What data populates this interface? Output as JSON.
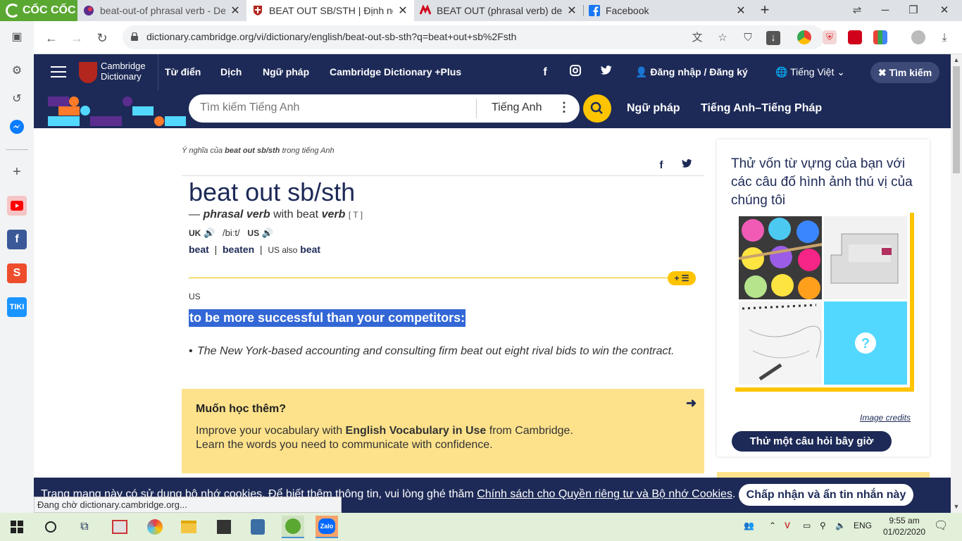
{
  "browser": {
    "brand": "CỐC CỐC",
    "tabs": [
      {
        "title": "beat-out-of phrasal verb - De",
        "active": false
      },
      {
        "title": "BEAT OUT SB/STH | Định nghĩ",
        "active": true
      },
      {
        "title": "BEAT OUT (phrasal verb) defi",
        "active": false
      },
      {
        "title": "Facebook",
        "active": false
      }
    ],
    "url": "dictionary.cambridge.org/vi/dictionary/english/beat-out-sb-sth?q=beat+out+sb%2Fsth",
    "status": "Đang chờ dictionary.cambridge.org..."
  },
  "header": {
    "logo_line1": "Cambridge",
    "logo_line2": "Dictionary",
    "nav": [
      "Từ điển",
      "Dịch",
      "Ngữ pháp",
      "Cambridge Dictionary +Plus"
    ],
    "login": "Đăng nhập / Đăng ký",
    "language": "Tiếng Việt",
    "search_button": "Tìm kiếm"
  },
  "searchbar": {
    "placeholder": "Tìm kiếm Tiếng Anh",
    "dictionary": "Tiếng Anh",
    "links": [
      "Ngữ pháp",
      "Tiếng Anh–Tiếng Pháp"
    ]
  },
  "entry": {
    "breadcrumb_prefix": "Ý nghĩa của",
    "breadcrumb_term": "beat out sb/sth",
    "breadcrumb_suffix": "trong tiếng Anh",
    "headword": "beat out sb/sth",
    "pos_dash": "—",
    "pos": "phrasal verb",
    "pos_with": "with beat",
    "pos_verb": "verb",
    "grammar": "[ T ]",
    "uk_label": "UK",
    "ipa": "/biːt/",
    "us_label": "US",
    "form1": "beat",
    "form2": "beaten",
    "us_also": "US also",
    "form3": "beat",
    "region": "US",
    "definition": "to be more successful than your competitors:",
    "example": "The New York-based accounting and consulting firm beat out eight rival bids to win the contract."
  },
  "promo": {
    "title": "Muốn học thêm?",
    "line1_a": "Improve your vocabulary with ",
    "line1_b": "English Vocabulary in Use",
    "line1_c": " from Cambridge.",
    "line2": "Learn the words you need to communicate with confidence."
  },
  "quiz": {
    "title": "Thử vốn từ vựng của bạn với các câu đố hình ảnh thú vị của chúng tôi",
    "credits": "Image credits",
    "button": "Thử một câu hỏi bây giờ"
  },
  "cookie": {
    "text": "Trang mạng này có sử dụng bộ nhớ cookies. Để biết thêm thông tin, vui lòng ghé thăm ",
    "link": "Chính sách cho Quyền riêng tư và Bộ nhớ Cookies",
    "end": ".",
    "button": "Chấp nhận và ẩn tin nhắn này"
  },
  "taskbar": {
    "lang": "ENG",
    "time": "9:55 am",
    "date": "01/02/2020"
  },
  "colors": {
    "cambridge_navy": "#1d2a57",
    "highlight_yellow": "#fec400",
    "selection_blue": "#3367d6",
    "promo_yellow": "#fde28b",
    "coccoc_green": "#5aa832"
  }
}
